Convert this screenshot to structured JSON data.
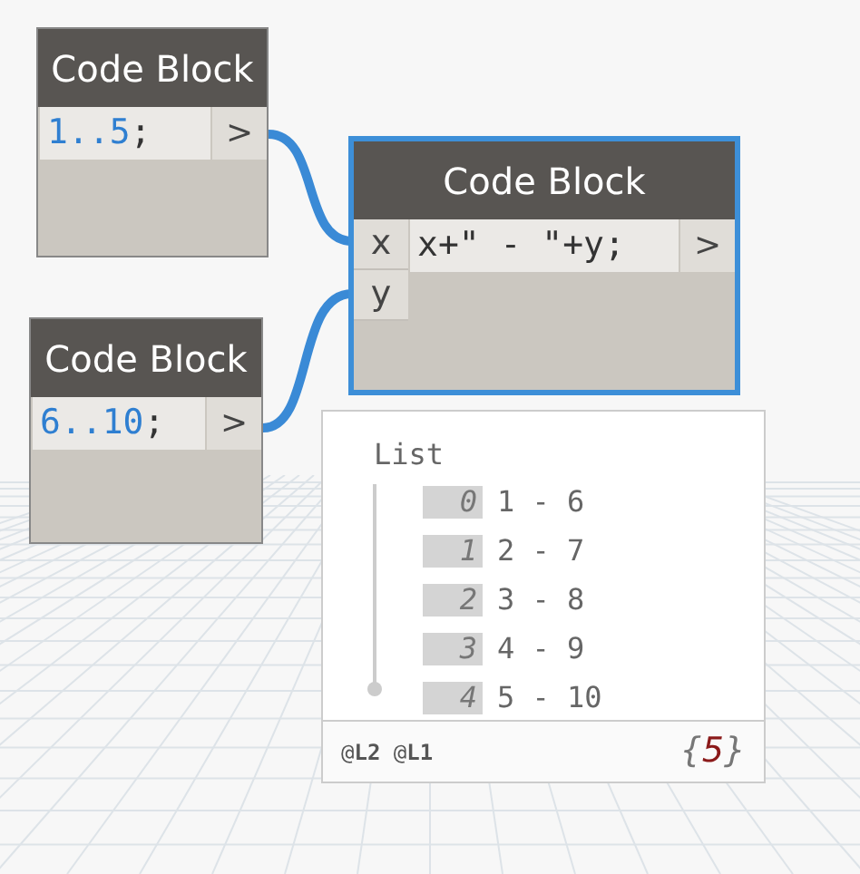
{
  "nodes": [
    {
      "title": "Code Block",
      "selected": false,
      "code": [
        {
          "text": "1..5",
          "kind": "number"
        },
        {
          "text": ";",
          "kind": "plain"
        }
      ],
      "output": ">"
    },
    {
      "title": "Code Block",
      "selected": true,
      "inputs": [
        "x",
        "y"
      ],
      "code": [
        {
          "text": "x+\" - \"+y;",
          "kind": "plain"
        }
      ],
      "output": ">"
    },
    {
      "title": "Code Block",
      "selected": false,
      "code": [
        {
          "text": "6..10",
          "kind": "number"
        },
        {
          "text": ";",
          "kind": "plain"
        }
      ],
      "output": ">"
    }
  ],
  "preview": {
    "header": "List",
    "items": [
      {
        "index": "0",
        "value": "1 - 6"
      },
      {
        "index": "1",
        "value": "2 - 7"
      },
      {
        "index": "2",
        "value": "3 - 8"
      },
      {
        "index": "3",
        "value": "4 - 9"
      },
      {
        "index": "4",
        "value": "5 - 10"
      }
    ],
    "levels": "@**L2** @**L1**",
    "count": [
      {
        "text": "{",
        "kind": "brace"
      },
      {
        "text": "5",
        "kind": "number"
      },
      {
        "text": "}",
        "kind": "brace"
      }
    ]
  }
}
